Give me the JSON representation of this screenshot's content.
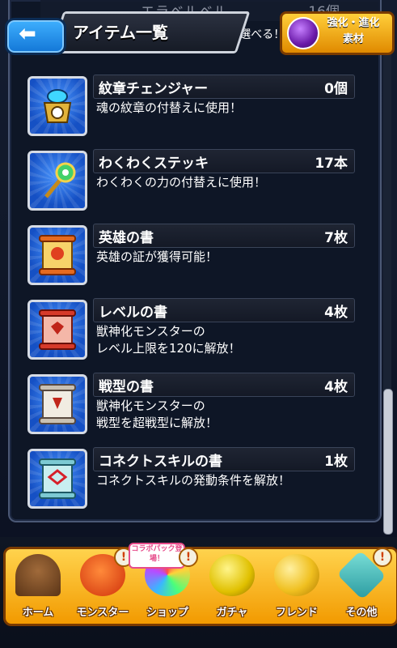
{
  "header": {
    "back_label": "⬅",
    "title": "アイテム一覧",
    "partial_item_name": "エラベルベル",
    "partial_item_count": "16個",
    "partial_item_desc": "ーンを選べる！",
    "badge_line1": "強化・進化",
    "badge_line2": "素材"
  },
  "items": [
    {
      "name": "紋章チェンジャー",
      "count": "0個",
      "desc1": "魂の紋章の付替えに使用！",
      "desc2": ""
    },
    {
      "name": "わくわくステッキ",
      "count": "17本",
      "desc1": "わくわくの力の付替えに使用！",
      "desc2": ""
    },
    {
      "name": "英雄の書",
      "count": "7枚",
      "desc1": "英雄の証が獲得可能！",
      "desc2": ""
    },
    {
      "name": "レベルの書",
      "count": "4枚",
      "desc1": "獣神化モンスターの",
      "desc2": "レベル上限を120に解放！"
    },
    {
      "name": "戦型の書",
      "count": "4枚",
      "desc1": "獣神化モンスターの",
      "desc2": "戦型を超戦型に解放！"
    },
    {
      "name": "コネクトスキルの書",
      "count": "1枚",
      "desc1": "コネクトスキルの発動条件を解放！",
      "desc2": ""
    }
  ],
  "nav": {
    "home": "ホーム",
    "monster": "モンスター",
    "shop": "ショップ",
    "shop_tag": "コラボパック登場！",
    "gacha": "ガチャ",
    "friend": "フレンド",
    "other": "その他",
    "alert": "!"
  },
  "colors": {
    "accent_blue": "#1f7be0",
    "nav_gold": "#f5b21c",
    "panel_bg": "#0e1626"
  }
}
